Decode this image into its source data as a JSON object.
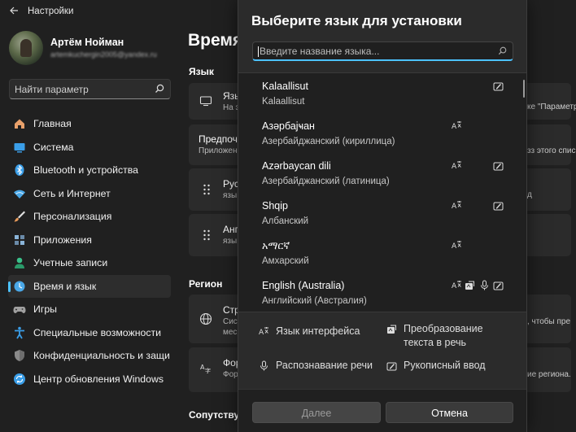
{
  "window": {
    "title": "Настройки"
  },
  "profile": {
    "name": "Артём Нойман",
    "email": "artemkuchergin2005@yandex.ru"
  },
  "sidebar": {
    "search_placeholder": "Найти параметр",
    "items": [
      {
        "label": "Главная",
        "icon": "home-icon",
        "color": "#e8a06a"
      },
      {
        "label": "Система",
        "icon": "system-icon",
        "color": "#3a9ee8"
      },
      {
        "label": "Bluetooth и устройства",
        "icon": "bluetooth-icon",
        "color": "#3a9ee8"
      },
      {
        "label": "Сеть и Интернет",
        "icon": "network-icon",
        "color": "#4aa8e8"
      },
      {
        "label": "Персонализация",
        "icon": "brush-icon",
        "color": "#e89a5a"
      },
      {
        "label": "Приложения",
        "icon": "apps-icon",
        "color": "#8ab4d8"
      },
      {
        "label": "Учетные записи",
        "icon": "accounts-icon",
        "color": "#3ac08a"
      },
      {
        "label": "Время и язык",
        "icon": "time-language-icon",
        "color": "#4aa8e8"
      },
      {
        "label": "Игры",
        "icon": "gaming-icon",
        "color": "#a0a0a0"
      },
      {
        "label": "Специальные возможности",
        "icon": "accessibility-icon",
        "color": "#3a9ee8"
      },
      {
        "label": "Конфиденциальность и защи",
        "icon": "shield-icon",
        "color": "#8a8a8a"
      },
      {
        "label": "Центр обновления Windows",
        "icon": "update-icon",
        "color": "#3a9ee8"
      }
    ],
    "active_index": 7
  },
  "main": {
    "heading": "Время",
    "section_language": "Язык",
    "section_region": "Регион",
    "section_related": "Сопутству",
    "cards": {
      "display_lang_title": "Язы",
      "display_lang_sub": "На э",
      "display_lang_right": "ке \"Параметры",
      "preferred_title": "Предпоч",
      "preferred_sub": "Приложен",
      "preferred_right": "зз этого спис",
      "lang1_title": "Рус",
      "lang1_sub": "язы",
      "lang1_right": "д",
      "lang2_title": "Анг",
      "lang2_sub": "язы",
      "region_title": "Стр",
      "region_sub1": "Сис",
      "region_sub2": "мес",
      "region_right": ", чтобы пре",
      "format_title": "Фор",
      "format_sub": "Фор",
      "format_right": "ие региона."
    }
  },
  "dialog": {
    "title": "Выберите язык для установки",
    "search_placeholder": "Введите название языка...",
    "languages": [
      {
        "name": "Kalaallisut",
        "native": "Kalaallisut",
        "features": [
          "handwriting"
        ]
      },
      {
        "name": "Азәрбајҹан",
        "native": "Азербайджанский (кириллица)",
        "features": [
          "display"
        ]
      },
      {
        "name": "Azərbaycan dili",
        "native": "Азербайджанский (латиница)",
        "features": [
          "display",
          "handwriting"
        ]
      },
      {
        "name": "Shqip",
        "native": "Албанский",
        "features": [
          "display",
          "handwriting"
        ]
      },
      {
        "name": "አማርኛ",
        "native": "Амхарский",
        "features": [
          "display"
        ]
      },
      {
        "name": "English (Australia)",
        "native": "Английский (Австралия)",
        "features": [
          "display",
          "tts",
          "speech",
          "handwriting"
        ]
      }
    ],
    "legend": {
      "display": "Язык интерфейса",
      "tts": "Преобразование текста в речь",
      "speech": "Распознавание речи",
      "handwriting": "Рукописный ввод"
    },
    "buttons": {
      "next": "Далее",
      "cancel": "Отмена"
    },
    "accent_color": "#4cc2ff"
  }
}
